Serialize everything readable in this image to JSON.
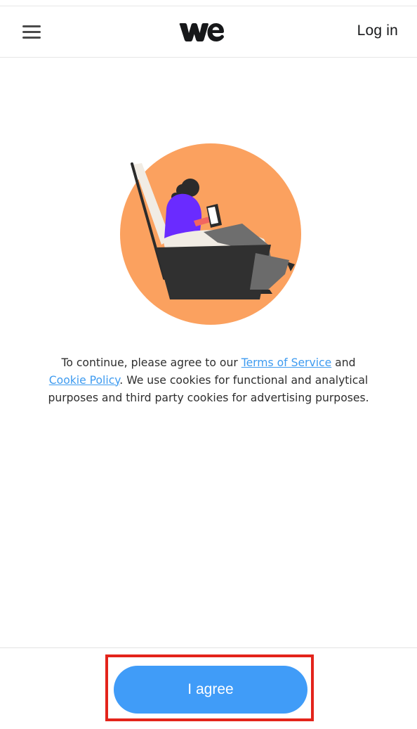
{
  "header": {
    "menu_icon": "hamburger-menu-icon",
    "logo_text": "we",
    "login_label": "Log in"
  },
  "consent": {
    "text_before": "To continue, please agree to our ",
    "terms_link": "Terms of Service",
    "text_middle": " and ",
    "cookie_link": "Cookie Policy",
    "text_after": ". We use cookies for functional and analytical purposes and third party cookies for advertising purposes."
  },
  "footer": {
    "agree_label": "I agree"
  },
  "colors": {
    "accent": "#409cf8",
    "link": "#3e9bf0",
    "illustration_circle": "#fba15f",
    "illustration_purple": "#6a2bff",
    "illustration_dark": "#2f2f2f",
    "highlight_border": "#e3241b"
  }
}
